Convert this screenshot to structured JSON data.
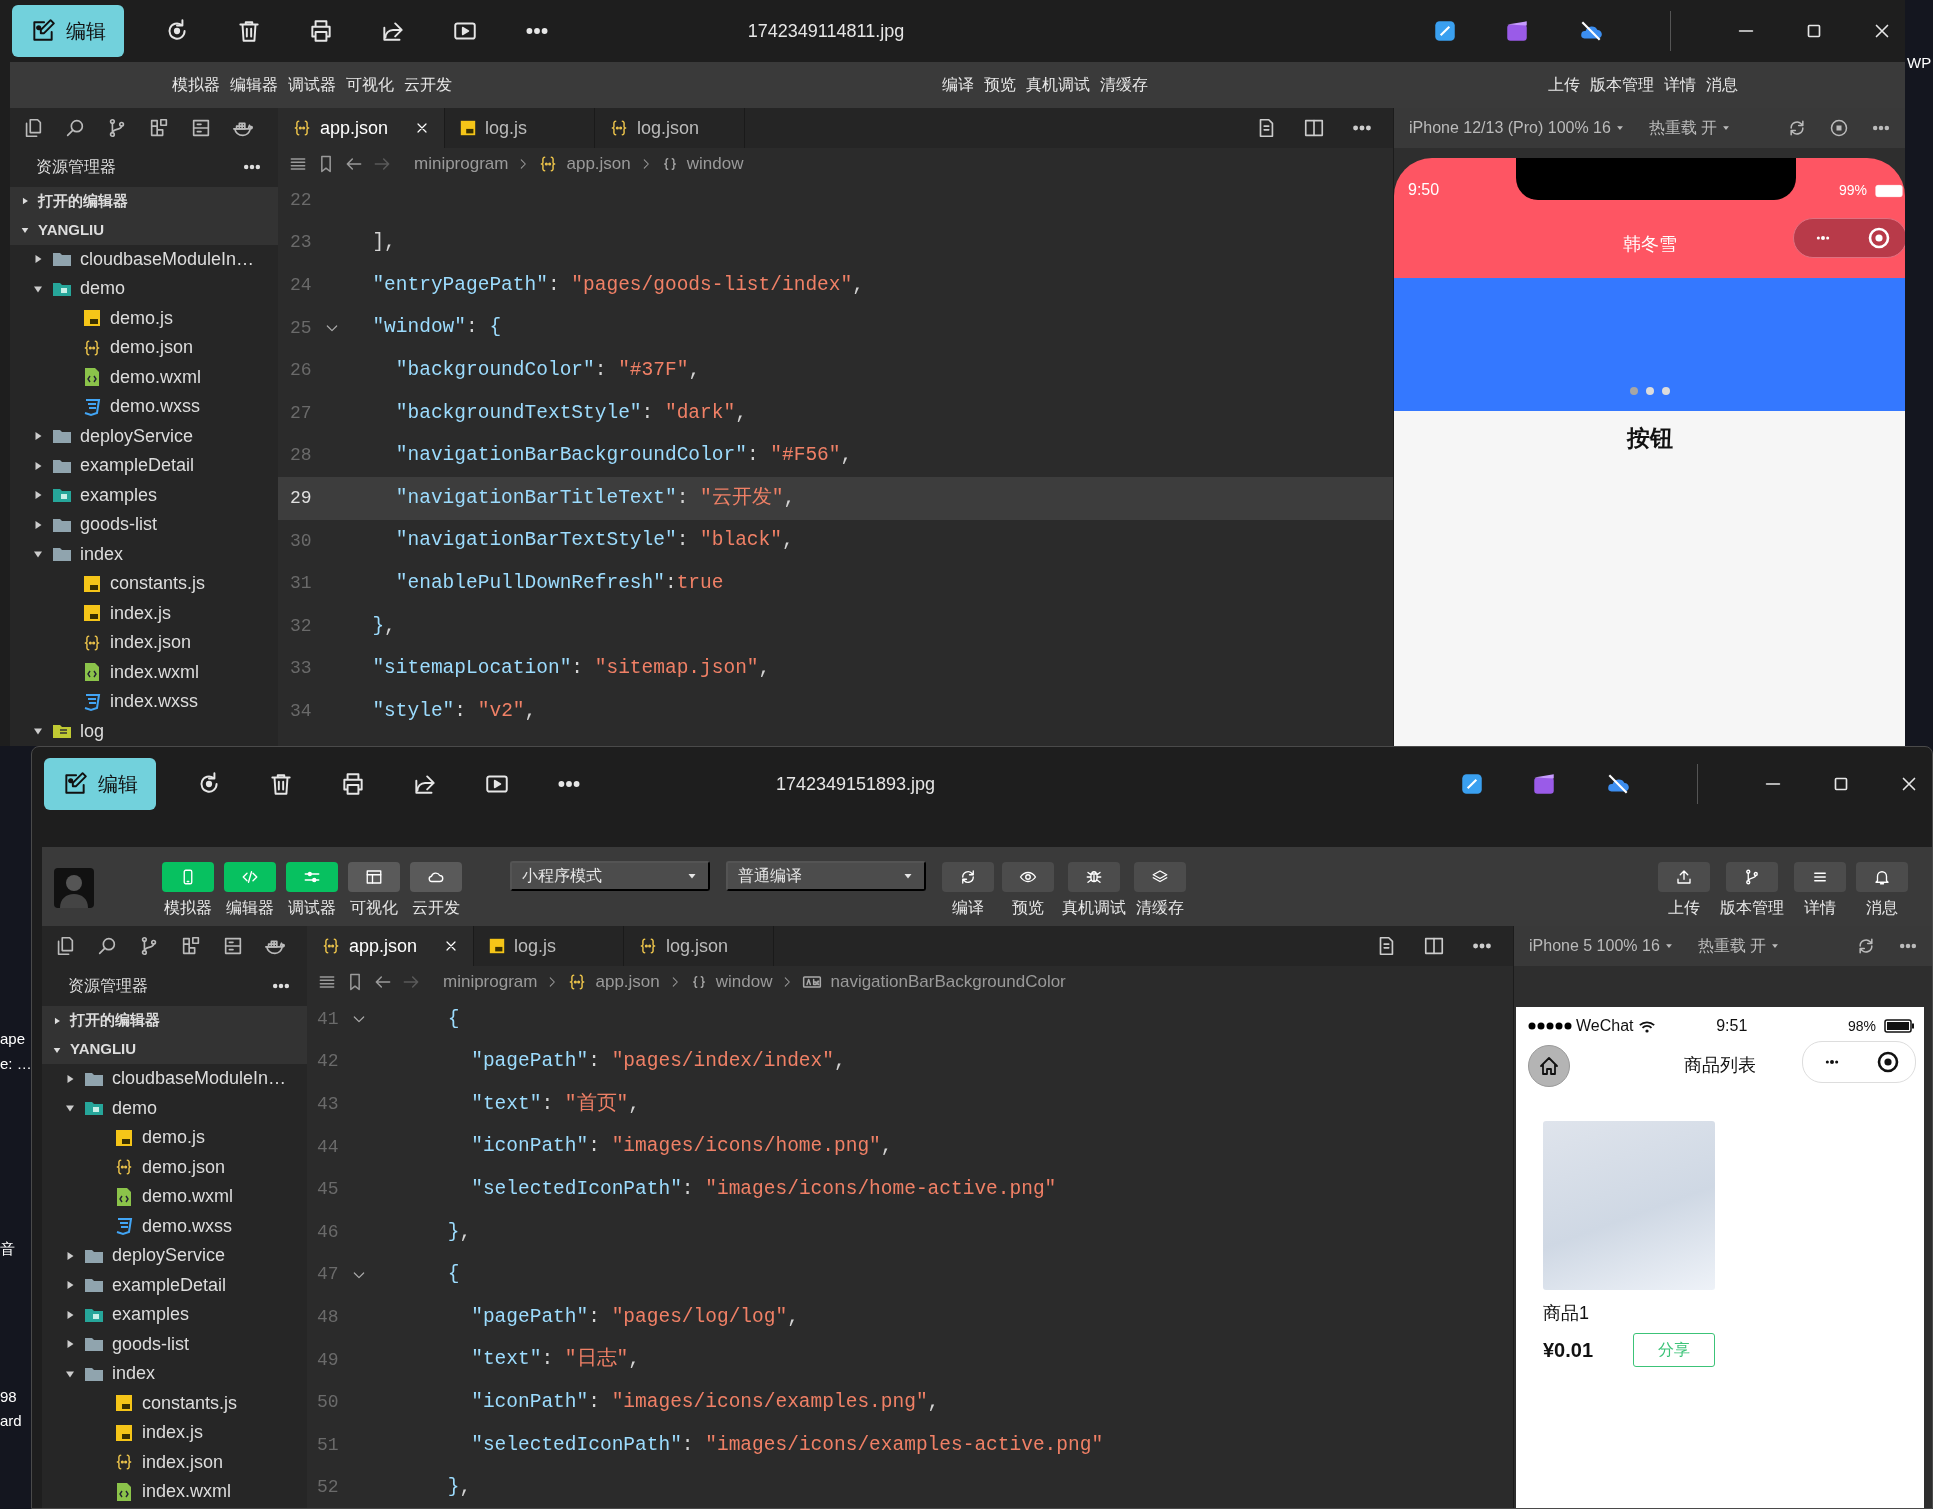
{
  "desktop": {
    "labels": [
      "WP",
      "ape",
      "e: …",
      "音",
      "98",
      "ard"
    ]
  },
  "windows": [
    {
      "viewer": {
        "edit_button": "编辑",
        "filename": "1742349114811.jpg"
      },
      "devtools": {
        "toolbar": {
          "labels_only": true,
          "groups": [
            {
              "items": [
                {
                  "label": "模拟器"
                },
                {
                  "label": "编辑器"
                },
                {
                  "label": "调试器"
                },
                {
                  "label": "可视化"
                },
                {
                  "label": "云开发"
                }
              ]
            },
            {
              "items": [
                {
                  "label": "编译"
                },
                {
                  "label": "预览"
                },
                {
                  "label": "真机调试"
                },
                {
                  "label": "清缓存"
                }
              ]
            },
            {
              "items": [
                {
                  "label": "上传"
                },
                {
                  "label": "版本管理"
                },
                {
                  "label": "详情"
                },
                {
                  "label": "消息"
                }
              ]
            }
          ]
        },
        "explorer": {
          "title": "资源管理器",
          "sections": [
            {
              "label": "打开的编辑器",
              "expanded": false
            },
            {
              "label": "YANGLIU",
              "expanded": true,
              "children": [
                {
                  "label": "cloudbaseModuleIn…",
                  "kind": "folder",
                  "expanded": false
                },
                {
                  "label": "demo",
                  "kind": "folder-app",
                  "expanded": true,
                  "children": [
                    {
                      "label": "demo.js",
                      "kind": "js"
                    },
                    {
                      "label": "demo.json",
                      "kind": "json"
                    },
                    {
                      "label": "demo.wxml",
                      "kind": "wxml"
                    },
                    {
                      "label": "demo.wxss",
                      "kind": "wxss"
                    }
                  ]
                },
                {
                  "label": "deployService",
                  "kind": "folder",
                  "expanded": false
                },
                {
                  "label": "exampleDetail",
                  "kind": "folder",
                  "expanded": false
                },
                {
                  "label": "examples",
                  "kind": "folder-app",
                  "expanded": false
                },
                {
                  "label": "goods-list",
                  "kind": "folder",
                  "expanded": false
                },
                {
                  "label": "index",
                  "kind": "folder",
                  "expanded": true,
                  "children": [
                    {
                      "label": "constants.js",
                      "kind": "js"
                    },
                    {
                      "label": "index.js",
                      "kind": "js"
                    },
                    {
                      "label": "index.json",
                      "kind": "json"
                    },
                    {
                      "label": "index.wxml",
                      "kind": "wxml"
                    },
                    {
                      "label": "index.wxss",
                      "kind": "wxss"
                    }
                  ]
                },
                {
                  "label": "log",
                  "kind": "folder-log",
                  "expanded": true
                }
              ]
            }
          ]
        },
        "file_tabs": [
          {
            "label": "app.json",
            "kind": "json",
            "selected": true
          },
          {
            "label": "log.js",
            "kind": "js",
            "selected": false
          },
          {
            "label": "log.json",
            "kind": "json",
            "selected": false
          }
        ],
        "breadcrumb": [
          {
            "label": "miniprogram",
            "kind": "folder"
          },
          {
            "label": "app.json",
            "kind": "json"
          },
          {
            "label": "window",
            "kind": "object"
          }
        ],
        "editor": {
          "lines": [
            {
              "number": "22",
              "current": false,
              "fold": false
            },
            {
              "number": "23",
              "current": false,
              "fold": false,
              "code": [
                {
                  "kind": "punct",
                  "text": "  ],"
                }
              ]
            },
            {
              "number": "24",
              "current": false,
              "fold": false,
              "code": [
                {
                  "kind": "key",
                  "text": "  \"entryPagePath\""
                },
                {
                  "kind": "punct",
                  "text": ": "
                },
                {
                  "kind": "string",
                  "text": "\"pages/goods-list/index\""
                },
                {
                  "kind": "punct",
                  "text": ","
                }
              ]
            },
            {
              "number": "25",
              "current": false,
              "fold": true,
              "code": [
                {
                  "kind": "key",
                  "text": "  \"window\""
                },
                {
                  "kind": "punct",
                  "text": ": "
                },
                {
                  "kind": "bracket",
                  "text": "{"
                }
              ]
            },
            {
              "number": "26",
              "current": false,
              "fold": false,
              "code": [
                {
                  "kind": "key",
                  "text": "    \"backgroundColor\""
                },
                {
                  "kind": "punct",
                  "text": ": "
                },
                {
                  "kind": "string",
                  "text": "\"#37F\""
                },
                {
                  "kind": "punct",
                  "text": ","
                }
              ]
            },
            {
              "number": "27",
              "current": false,
              "fold": false,
              "code": [
                {
                  "kind": "key",
                  "text": "    \"backgroundTextStyle\""
                },
                {
                  "kind": "punct",
                  "text": ": "
                },
                {
                  "kind": "string",
                  "text": "\"dark\""
                },
                {
                  "kind": "punct",
                  "text": ","
                }
              ]
            },
            {
              "number": "28",
              "current": false,
              "fold": false,
              "code": [
                {
                  "kind": "key",
                  "text": "    \"navigationBarBackgroundColor\""
                },
                {
                  "kind": "punct",
                  "text": ": "
                },
                {
                  "kind": "string",
                  "text": "\"#F56\""
                },
                {
                  "kind": "punct",
                  "text": ","
                }
              ]
            },
            {
              "number": "29",
              "current": true,
              "fold": false,
              "code": [
                {
                  "kind": "key",
                  "text": "    \"navigationBarTitleText\""
                },
                {
                  "kind": "punct",
                  "text": ": "
                },
                {
                  "kind": "string",
                  "text": "\"云开发\""
                },
                {
                  "kind": "punct",
                  "text": ","
                }
              ]
            },
            {
              "number": "30",
              "current": false,
              "fold": false,
              "code": [
                {
                  "kind": "key",
                  "text": "    \"navigationBarTextStyle\""
                },
                {
                  "kind": "punct",
                  "text": ": "
                },
                {
                  "kind": "string",
                  "text": "\"black\""
                },
                {
                  "kind": "punct",
                  "text": ","
                }
              ]
            },
            {
              "number": "31",
              "current": false,
              "fold": false,
              "code": [
                {
                  "kind": "key",
                  "text": "    \"enablePullDownRefresh\""
                },
                {
                  "kind": "punct",
                  "text": ":"
                },
                {
                  "kind": "literal",
                  "text": "true"
                }
              ]
            },
            {
              "number": "32",
              "current": false,
              "fold": false,
              "code": [
                {
                  "kind": "bracket",
                  "text": "  }"
                },
                {
                  "kind": "punct",
                  "text": ","
                }
              ]
            },
            {
              "number": "33",
              "current": false,
              "fold": false,
              "code": [
                {
                  "kind": "key",
                  "text": "  \"sitemapLocation\""
                },
                {
                  "kind": "punct",
                  "text": ": "
                },
                {
                  "kind": "string",
                  "text": "\"sitemap.json\""
                },
                {
                  "kind": "punct",
                  "text": ","
                }
              ]
            },
            {
              "number": "34",
              "current": false,
              "fold": false,
              "code": [
                {
                  "kind": "key",
                  "text": "  \"style\""
                },
                {
                  "kind": "punct",
                  "text": ": "
                },
                {
                  "kind": "string",
                  "text": "\"v2\""
                },
                {
                  "kind": "punct",
                  "text": ","
                }
              ]
            }
          ]
        },
        "simulator": {
          "device": "iPhone 12/13 (Pro) 100% 16",
          "hot_reload": "热重载 开",
          "phone": {
            "kind": "notch",
            "time": "9:50",
            "battery": "99%",
            "title": "韩冬雪",
            "dots": [
              {
                "selected": true
              },
              {
                "selected": false
              },
              {
                "selected": false
              }
            ],
            "heading": "按钮"
          }
        }
      }
    },
    {
      "viewer": {
        "edit_button": "编辑",
        "filename": "1742349151893.jpg"
      },
      "devtools": {
        "toolbar": {
          "labels_only": false,
          "groups": [
            {
              "items": [
                {
                  "label": "模拟器",
                  "on": true
                },
                {
                  "label": "编辑器",
                  "on": true
                },
                {
                  "label": "调试器",
                  "on": true
                },
                {
                  "label": "可视化",
                  "on": false
                },
                {
                  "label": "云开发",
                  "on": false
                }
              ]
            },
            {
              "items": [
                {
                  "label": "编译"
                },
                {
                  "label": "预览"
                },
                {
                  "label": "真机调试"
                },
                {
                  "label": "清缓存"
                }
              ]
            },
            {
              "items": [
                {
                  "label": "上传"
                },
                {
                  "label": "版本管理"
                },
                {
                  "label": "详情"
                },
                {
                  "label": "消息"
                }
              ]
            }
          ],
          "dropdowns": [
            "小程序模式",
            "普通编译"
          ]
        },
        "explorer": {
          "title": "资源管理器",
          "sections": [
            {
              "label": "打开的编辑器",
              "expanded": false
            },
            {
              "label": "YANGLIU",
              "expanded": true,
              "children": [
                {
                  "label": "cloudbaseModuleIn…",
                  "kind": "folder",
                  "expanded": false
                },
                {
                  "label": "demo",
                  "kind": "folder-app",
                  "expanded": true,
                  "children": [
                    {
                      "label": "demo.js",
                      "kind": "js"
                    },
                    {
                      "label": "demo.json",
                      "kind": "json"
                    },
                    {
                      "label": "demo.wxml",
                      "kind": "wxml"
                    },
                    {
                      "label": "demo.wxss",
                      "kind": "wxss"
                    }
                  ]
                },
                {
                  "label": "deployService",
                  "kind": "folder",
                  "expanded": false
                },
                {
                  "label": "exampleDetail",
                  "kind": "folder",
                  "expanded": false
                },
                {
                  "label": "examples",
                  "kind": "folder-app",
                  "expanded": false
                },
                {
                  "label": "goods-list",
                  "kind": "folder",
                  "expanded": false
                },
                {
                  "label": "index",
                  "kind": "folder",
                  "expanded": true,
                  "children": [
                    {
                      "label": "constants.js",
                      "kind": "js"
                    },
                    {
                      "label": "index.js",
                      "kind": "js"
                    },
                    {
                      "label": "index.json",
                      "kind": "json"
                    },
                    {
                      "label": "index.wxml",
                      "kind": "wxml"
                    }
                  ]
                }
              ]
            }
          ]
        },
        "file_tabs": [
          {
            "label": "app.json",
            "kind": "json",
            "selected": true
          },
          {
            "label": "log.js",
            "kind": "js",
            "selected": false
          },
          {
            "label": "log.json",
            "kind": "json",
            "selected": false
          }
        ],
        "breadcrumb": [
          {
            "label": "miniprogram",
            "kind": "folder"
          },
          {
            "label": "app.json",
            "kind": "json"
          },
          {
            "label": "window",
            "kind": "object"
          },
          {
            "label": "navigationBarBackgroundColor",
            "kind": "string"
          }
        ],
        "editor": {
          "lines": [
            {
              "number": "41",
              "current": false,
              "fold": true,
              "code": [
                {
                  "kind": "bracket",
                  "text": "    {"
                }
              ]
            },
            {
              "number": "42",
              "current": false,
              "fold": false,
              "code": [
                {
                  "kind": "key",
                  "text": "      \"pagePath\""
                },
                {
                  "kind": "punct",
                  "text": ": "
                },
                {
                  "kind": "string",
                  "text": "\"pages/index/index\""
                },
                {
                  "kind": "punct",
                  "text": ","
                }
              ]
            },
            {
              "number": "43",
              "current": false,
              "fold": false,
              "code": [
                {
                  "kind": "key",
                  "text": "      \"text\""
                },
                {
                  "kind": "punct",
                  "text": ": "
                },
                {
                  "kind": "string",
                  "text": "\"首页\""
                },
                {
                  "kind": "punct",
                  "text": ","
                }
              ]
            },
            {
              "number": "44",
              "current": false,
              "fold": false,
              "code": [
                {
                  "kind": "key",
                  "text": "      \"iconPath\""
                },
                {
                  "kind": "punct",
                  "text": ": "
                },
                {
                  "kind": "string",
                  "text": "\"images/icons/home.png\""
                },
                {
                  "kind": "punct",
                  "text": ","
                }
              ]
            },
            {
              "number": "45",
              "current": false,
              "fold": false,
              "code": [
                {
                  "kind": "key",
                  "text": "      \"selectedIconPath\""
                },
                {
                  "kind": "punct",
                  "text": ": "
                },
                {
                  "kind": "string",
                  "text": "\"images/icons/home-active.png\""
                }
              ]
            },
            {
              "number": "46",
              "current": false,
              "fold": false,
              "code": [
                {
                  "kind": "bracket",
                  "text": "    }"
                },
                {
                  "kind": "punct",
                  "text": ","
                }
              ]
            },
            {
              "number": "47",
              "current": false,
              "fold": true,
              "code": [
                {
                  "kind": "bracket",
                  "text": "    {"
                }
              ]
            },
            {
              "number": "48",
              "current": false,
              "fold": false,
              "code": [
                {
                  "kind": "key",
                  "text": "      \"pagePath\""
                },
                {
                  "kind": "punct",
                  "text": ": "
                },
                {
                  "kind": "string",
                  "text": "\"pages/log/log\""
                },
                {
                  "kind": "punct",
                  "text": ","
                }
              ]
            },
            {
              "number": "49",
              "current": false,
              "fold": false,
              "code": [
                {
                  "kind": "key",
                  "text": "      \"text\""
                },
                {
                  "kind": "punct",
                  "text": ": "
                },
                {
                  "kind": "string",
                  "text": "\"日志\""
                },
                {
                  "kind": "punct",
                  "text": ","
                }
              ]
            },
            {
              "number": "50",
              "current": false,
              "fold": false,
              "code": [
                {
                  "kind": "key",
                  "text": "      \"iconPath\""
                },
                {
                  "kind": "punct",
                  "text": ": "
                },
                {
                  "kind": "string",
                  "text": "\"images/icons/examples.png\""
                },
                {
                  "kind": "punct",
                  "text": ","
                }
              ]
            },
            {
              "number": "51",
              "current": false,
              "fold": false,
              "code": [
                {
                  "kind": "key",
                  "text": "      \"selectedIconPath\""
                },
                {
                  "kind": "punct",
                  "text": ": "
                },
                {
                  "kind": "string",
                  "text": "\"images/icons/examples-active.png\""
                }
              ]
            },
            {
              "number": "52",
              "current": false,
              "fold": false,
              "code": [
                {
                  "kind": "bracket",
                  "text": "    }"
                },
                {
                  "kind": "punct",
                  "text": ","
                }
              ]
            }
          ]
        },
        "simulator": {
          "device": "iPhone 5 100% 16",
          "hot_reload": "热重载 开",
          "phone": {
            "kind": "classic",
            "carrier": "WeChat",
            "time": "9:51",
            "battery": "98%",
            "title": "商品列表",
            "products": [
              {
                "name": "商品1",
                "price": "¥0.01",
                "share": "分享"
              }
            ]
          }
        }
      }
    }
  ]
}
